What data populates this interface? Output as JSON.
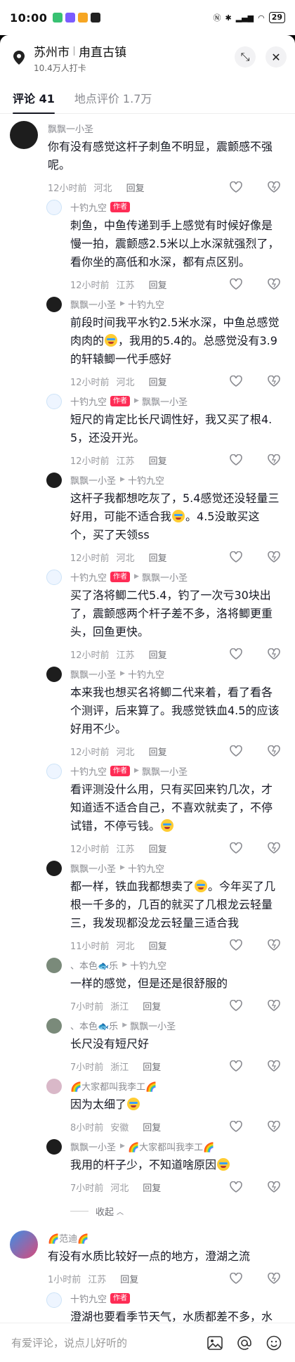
{
  "status": {
    "time": "10:00",
    "battery": "29"
  },
  "header": {
    "city": "苏州市",
    "town": "甪直古镇",
    "checkins": "10.4万人打卡"
  },
  "tabs": [
    {
      "label": "评论 41",
      "active": true
    },
    {
      "label": "地点评价 1.7万",
      "active": false
    }
  ],
  "comments": [
    {
      "type": "main",
      "user": "飘飘一小圣",
      "author": false,
      "reply_to": "",
      "avatar": "k",
      "text": "你有没有感觉这杆子刺鱼不明显，震颤感不强呢。",
      "emoji": false,
      "time": "12小时前",
      "loc": "河北",
      "reply": "回复"
    },
    {
      "type": "reply",
      "user": "十钓九空",
      "author": true,
      "reply_to": "",
      "avatar": "s",
      "text": "刺鱼，中鱼传递到手上感觉有时候好像是慢一拍，震颤感2.5米以上水深就强烈了，看你坐的高低和水深，都有点区别。",
      "emoji": false,
      "time": "12小时前",
      "loc": "江苏",
      "reply": "回复"
    },
    {
      "type": "reply",
      "user": "飘飘一小圣",
      "author": false,
      "reply_to": "十钓九空",
      "avatar": "k",
      "text": "前段时间我平水钓2.5米水深，中鱼总感觉肉肉的",
      "text2": "，我用的5.4的。总感觉没有3.9的轩辕鲫一代手感好",
      "emoji": true,
      "time": "12小时前",
      "loc": "河北",
      "reply": "回复"
    },
    {
      "type": "reply",
      "user": "十钓九空",
      "author": true,
      "reply_to": "飘飘一小圣",
      "avatar": "s",
      "text": "短尺的肯定比长尺调性好，我又买了根4.5，还没开光。",
      "emoji": false,
      "time": "12小时前",
      "loc": "江苏",
      "reply": "回复"
    },
    {
      "type": "reply",
      "user": "飘飘一小圣",
      "author": false,
      "reply_to": "十钓九空",
      "avatar": "k",
      "text": "这杆子我都想吃灰了，5.4感觉还没轻量三好用，可能不适合我",
      "text2": "。4.5没敢买这个，买了天领ss",
      "emoji": true,
      "time": "12小时前",
      "loc": "河北",
      "reply": "回复"
    },
    {
      "type": "reply",
      "user": "十钓九空",
      "author": true,
      "reply_to": "飘飘一小圣",
      "avatar": "s",
      "text": "买了洛将鲫二代5.4，钓了一次亏30块出了，震颤感两个杆子差不多，洛将鲫更重头，回鱼更快。",
      "emoji": false,
      "time": "12小时前",
      "loc": "江苏",
      "reply": "回复"
    },
    {
      "type": "reply",
      "user": "飘飘一小圣",
      "author": false,
      "reply_to": "十钓九空",
      "avatar": "k",
      "text": "本来我也想买名将鲫二代来着，看了看各个测评，后来算了。我感觉铁血4.5的应该好用不少。",
      "emoji": false,
      "time": "12小时前",
      "loc": "河北",
      "reply": "回复"
    },
    {
      "type": "reply",
      "user": "十钓九空",
      "author": true,
      "reply_to": "飘飘一小圣",
      "avatar": "s",
      "text": "看评测没什么用，只有买回来钓几次，才知道适不适合自己，不喜欢就卖了，不停试错，不停亏钱。",
      "emoji": true,
      "time": "12小时前",
      "loc": "江苏",
      "reply": "回复"
    },
    {
      "type": "reply",
      "user": "飘飘一小圣",
      "author": false,
      "reply_to": "十钓九空",
      "avatar": "k",
      "text": "都一样，铁血我都想卖了",
      "text2": "。今年买了几根一千多的，几百的就买了几根龙云轻量三，我发现都没龙云轻量三适合我",
      "emoji": true,
      "time": "11小时前",
      "loc": "河北",
      "reply": "回复"
    },
    {
      "type": "reply",
      "user": "、本色🐟乐",
      "author": false,
      "reply_to": "十钓九空",
      "avatar": "b",
      "text": "一样的感觉，但是还是很舒服的",
      "emoji": false,
      "time": "7小时前",
      "loc": "浙江",
      "reply": "回复"
    },
    {
      "type": "reply",
      "user": "、本色🐟乐",
      "author": false,
      "reply_to": "飘飘一小圣",
      "avatar": "b",
      "text": "长尺没有短尺好",
      "emoji": false,
      "time": "7小时前",
      "loc": "浙江",
      "reply": "回复"
    },
    {
      "type": "reply",
      "user": "🌈大家都叫我李工🌈",
      "author": false,
      "reply_to": "",
      "avatar": "d",
      "text": "因为太细了",
      "emoji": true,
      "time": "8小时前",
      "loc": "安徽",
      "reply": "回复"
    },
    {
      "type": "reply",
      "user": "飘飘一小圣",
      "author": false,
      "reply_to": "🌈大家都叫我李工🌈",
      "avatar": "k",
      "text": "我用的杆子少，不知道啥原因",
      "emoji": true,
      "time": "7小时前",
      "loc": "河北",
      "reply": "回复"
    }
  ],
  "collapse_label": "收起",
  "second": {
    "user": "🌈范迪🌈",
    "text": "有没有水质比较好一点的地方，澄湖之流",
    "time": "1小时前",
    "loc": "江苏",
    "reply": "回复"
  },
  "second_reply": {
    "user": "十钓九空",
    "author_tag": "作者",
    "text": "澄湖也要看季节天气，水质都差不多，水"
  },
  "author_tag": "作者",
  "input_placeholder": "有爱评论，说点儿好听的"
}
